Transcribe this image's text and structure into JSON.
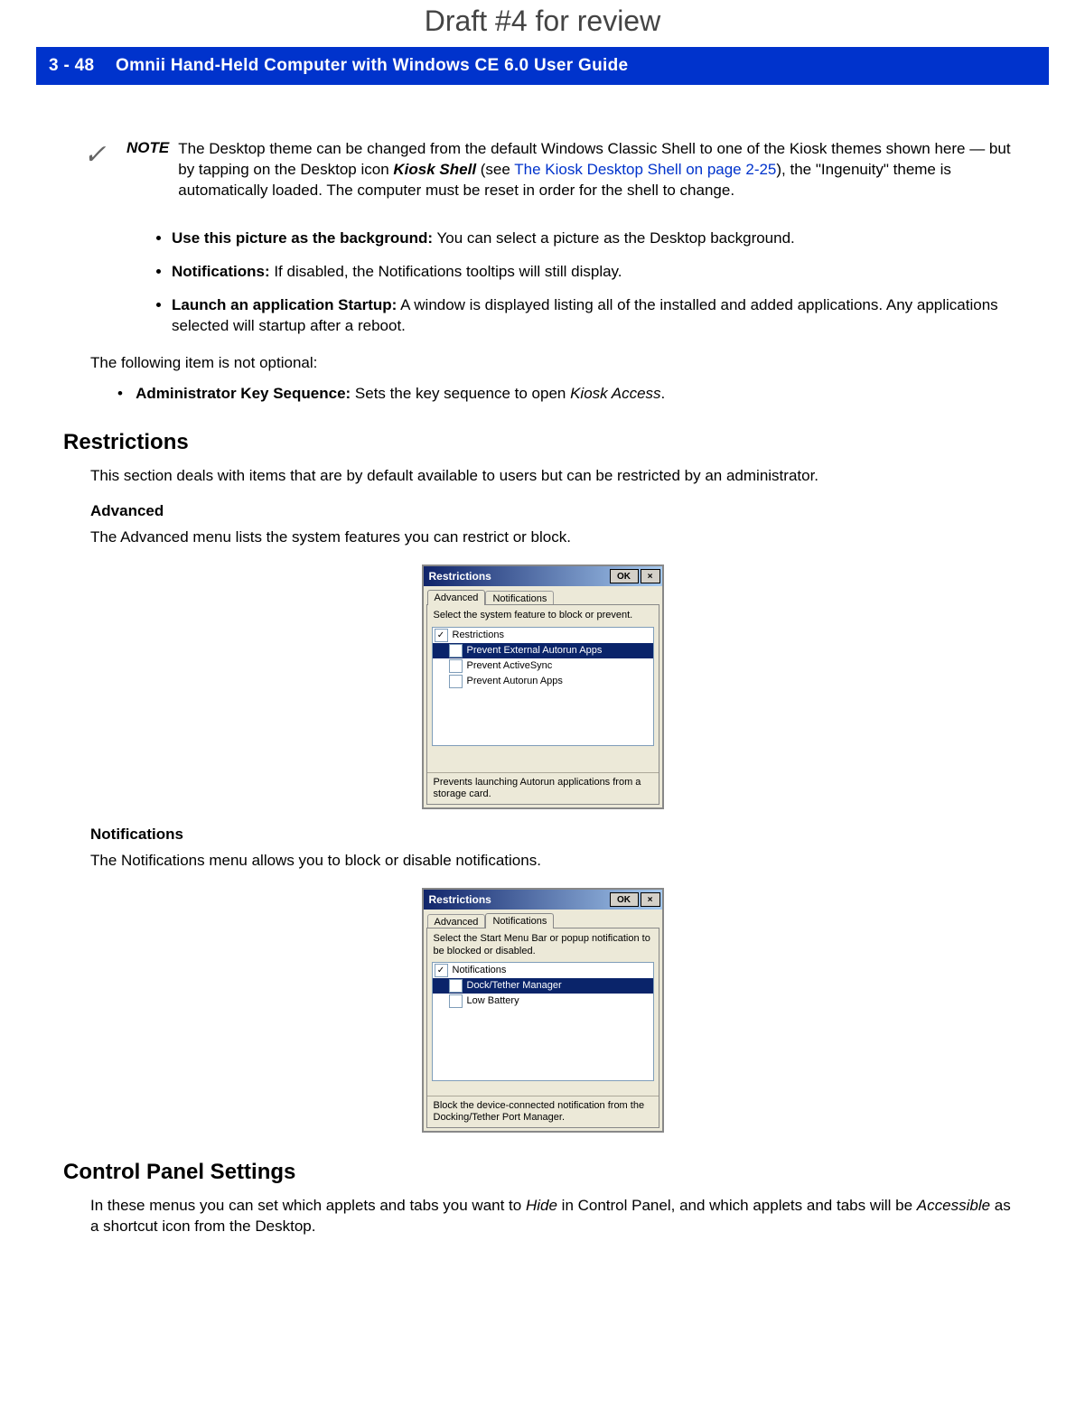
{
  "draft_header": "Draft #4 for review",
  "bar": {
    "page_num": "3 - 48",
    "title": "Omnii Hand-Held Computer with Windows CE 6.0 User Guide"
  },
  "note": {
    "check": "✓",
    "label": "NOTE",
    "text_pre": "The Desktop theme can be changed from the default Windows Classic Shell to one of the Kiosk themes shown here — but by tapping on the Desktop icon ",
    "kiosk_shell": "Kiosk Shell",
    "text_mid": " (see ",
    "link": "The Kiosk Desktop Shell on page 2-25",
    "text_post": "), the \"Ingenuity\" theme is automatically loaded. The computer must be reset in order for the shell to change."
  },
  "bullets": [
    {
      "lead": "Use this picture as the background:",
      "rest": " You can select a picture as the Desktop background."
    },
    {
      "lead": "Notifications:",
      "rest": " If disabled, the Notifications tooltips will still display."
    },
    {
      "lead": "Launch an application Startup:",
      "rest": " A window is displayed listing all of the installed and added applications. Any applications selected will startup after a reboot."
    }
  ],
  "not_optional_intro": "The following item is not optional:",
  "admin_key": {
    "lead": "Administrator Key Sequence:",
    "rest": " Sets the key sequence to open ",
    "italic": "Kiosk Access",
    "tail": "."
  },
  "restrictions": {
    "heading": "Restrictions",
    "intro": "This section deals with items that are by default available to users but can be restricted by an administrator.",
    "advanced": {
      "heading": "Advanced",
      "text": "The Advanced menu lists the system features you can restrict or block."
    },
    "notifications": {
      "heading": "Notifications",
      "text": "The Notifications menu allows you to block or disable notifications."
    }
  },
  "control_panel": {
    "heading": "Control Panel Settings",
    "text_pre": "In these menus you can set which applets and tabs you want to ",
    "hide": "Hide",
    "text_mid": " in Control Panel, and which applets and tabs will be ",
    "accessible": "Accessible",
    "text_post": " as a shortcut icon from the Desktop."
  },
  "dialog1": {
    "title": "Restrictions",
    "ok": "OK",
    "close": "×",
    "tab_active": "Advanced",
    "tab_inactive": "Notifications",
    "instruction": "Select the system feature to block or prevent.",
    "root": "Restrictions",
    "items": [
      {
        "label": "Prevent External Autorun Apps",
        "selected": true,
        "checked": false
      },
      {
        "label": "Prevent ActiveSync",
        "selected": false,
        "checked": false
      },
      {
        "label": "Prevent Autorun Apps",
        "selected": false,
        "checked": false
      }
    ],
    "status": "Prevents launching Autorun applications from a storage card."
  },
  "dialog2": {
    "title": "Restrictions",
    "ok": "OK",
    "close": "×",
    "tab_active": "Notifications",
    "tab_inactive": "Advanced",
    "instruction": "Select the Start Menu Bar or popup notification to be blocked or disabled.",
    "root": "Notifications",
    "items": [
      {
        "label": "Dock/Tether Manager",
        "selected": true,
        "checked": false
      },
      {
        "label": "Low Battery",
        "selected": false,
        "checked": false
      }
    ],
    "status": "Block the device-connected notification from the Docking/Tether Port Manager."
  }
}
